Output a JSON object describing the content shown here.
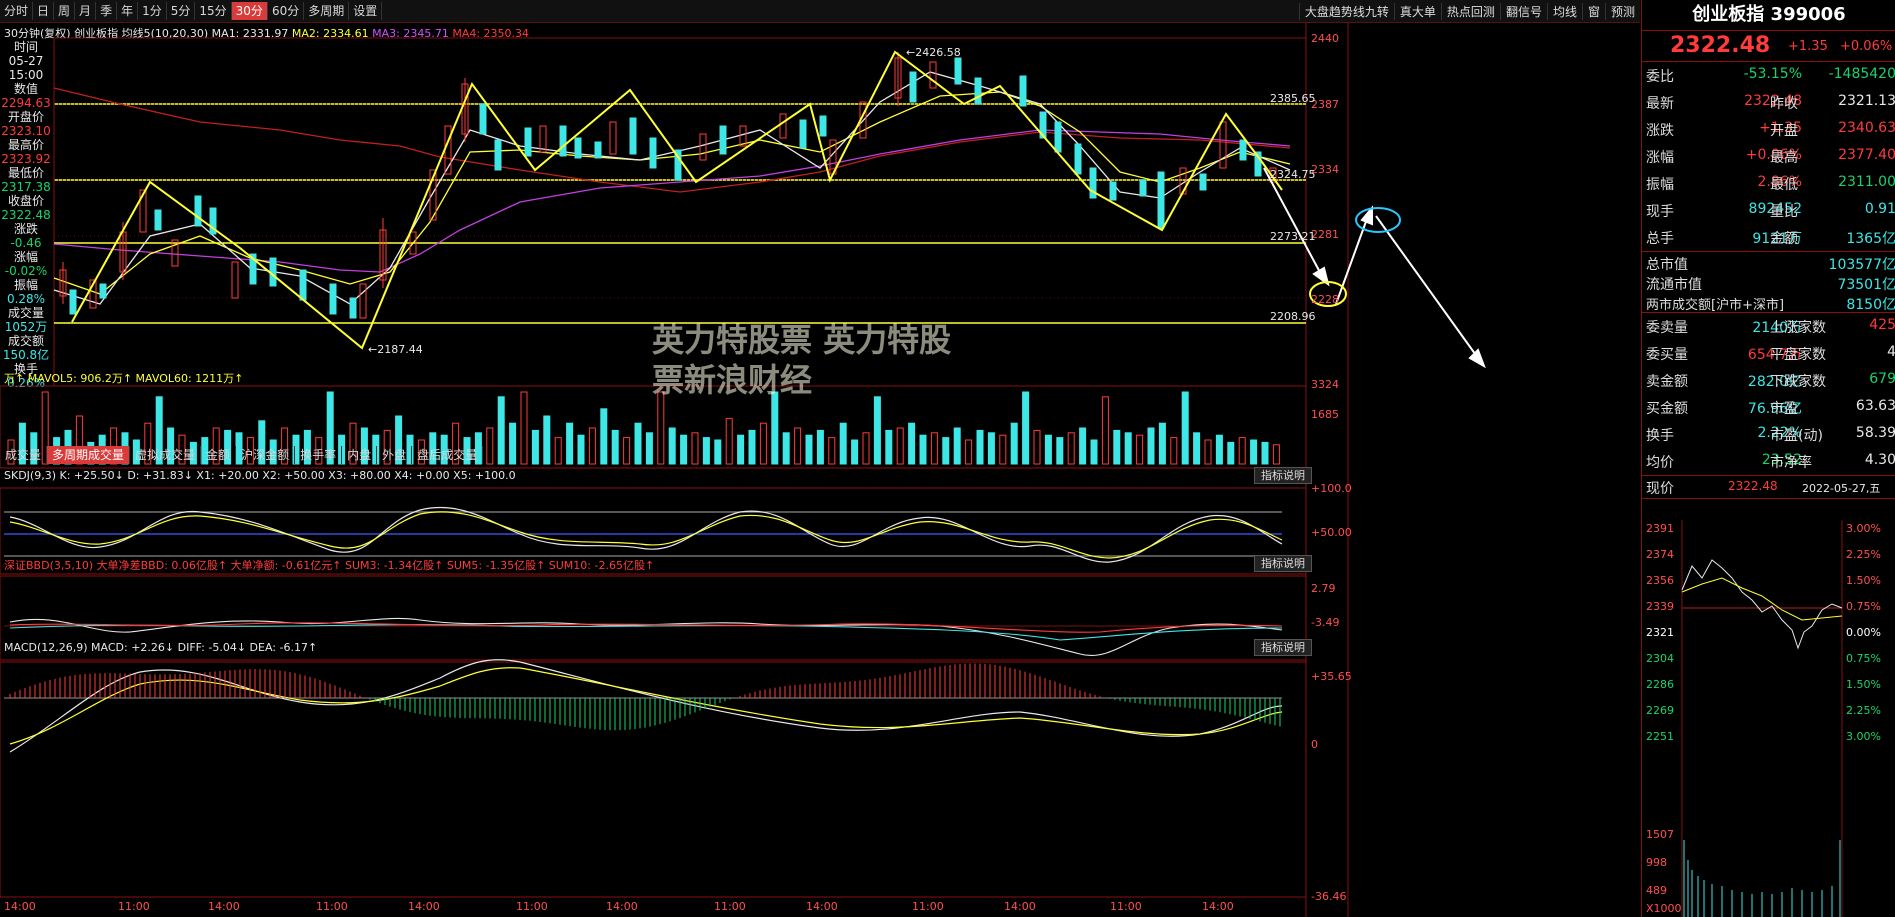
{
  "toolbar": {
    "tabs": [
      "分时",
      "日",
      "周",
      "月",
      "季",
      "年",
      "1分",
      "5分",
      "15分",
      "30分",
      "60分",
      "多周期",
      "设置"
    ],
    "active_tab": "30分",
    "right_items": [
      "大盘趋势线九转",
      "真大单",
      "热点回测",
      "翻信号",
      "均线",
      "窗",
      "预测"
    ]
  },
  "chart_header": {
    "period": "30分钟(复权)",
    "name": "创业板指",
    "ma_label": "均线5(10,20,30)",
    "ma1": "MA1: 2331.97",
    "ma2": "MA2: 2334.61",
    "ma3": "MA3: 2345.71",
    "ma4": "MA4: 2350.34"
  },
  "left_info": [
    {
      "label": "时间",
      "value": "05-27"
    },
    {
      "label": "",
      "value": "15:00"
    },
    {
      "label": "数值",
      "value": "2294.63"
    },
    {
      "label": "开盘价",
      "value": "2323.10"
    },
    {
      "label": "最高价",
      "value": "2323.92"
    },
    {
      "label": "最低价",
      "value": "2317.38"
    },
    {
      "label": "收盘价",
      "value": "2322.48"
    },
    {
      "label": "涨跌",
      "value": "-0.46"
    },
    {
      "label": "涨幅",
      "value": "-0.02%"
    },
    {
      "label": "振幅",
      "value": "0.28%"
    },
    {
      "label": "成交量",
      "value": "1052万"
    },
    {
      "label": "成交额",
      "value": "150.8亿"
    },
    {
      "label": "换手",
      "value": "0.26%"
    }
  ],
  "price_axis": [
    "2440",
    "2387",
    "2334",
    "2281",
    "2228"
  ],
  "annotations": {
    "high": "2426.58",
    "low": "2187.44",
    "line1": "2385.65",
    "line2": "2324.75",
    "line3": "2273.21",
    "line4": "2208.96"
  },
  "volume": {
    "header": "万↑ MAVOL5: 906.2万↑ MAVOL60: 1211万↑",
    "axis": [
      "3324",
      "1685"
    ]
  },
  "indicator_tabs": [
    "成交量",
    "多周期成交量",
    "虚拟成交量",
    "金额",
    "沪深金额",
    "换手率",
    "内盘",
    "外盘",
    "盘后成交量"
  ],
  "indicator_active": "多周期成交量",
  "skdj": {
    "header": "SKDJ(9,3) K: +25.50↓ D: +31.83↓ X1: +20.00 X2: +50.00 X3: +80.00 X4: +0.00 X5: +100.0",
    "axis": [
      "+100.0",
      "+50.00"
    ],
    "btn": "指标说明"
  },
  "bbd": {
    "header": "深证BBD(3,5,10) 大单净差BBD: 0.06亿股↑ 大单净额: -0.61亿元↑ SUM3: -1.34亿股↑ SUM5: -1.35亿股↑ SUM10: -2.65亿股↑",
    "axis": [
      "2.79",
      "-3.49"
    ],
    "btn": "指标说明"
  },
  "macd": {
    "header": "MACD(12,26,9) MACD: +2.26↓ DIFF: -5.04↓ DEA: -6.17↑",
    "axis": [
      "+35.65",
      "0",
      "-36.46"
    ],
    "btn": "指标说明"
  },
  "x_axis": [
    "14:00",
    "11:00",
    "14:00",
    "11:00",
    "14:00",
    "11:00",
    "14:00",
    "11:00",
    "14:00",
    "11:00",
    "14:00",
    "11:00",
    "14:00"
  ],
  "right_panel": {
    "title": "创业板指 399006",
    "price": "2322.48",
    "change": "+1.35",
    "change_pct": "+0.06%",
    "rows": [
      {
        "l": "委比",
        "v": "-53.15%",
        "l2": "",
        "v2": "-1485420"
      },
      {
        "l": "最新",
        "v": "2322.48",
        "l2": "昨收",
        "v2": "2321.13"
      },
      {
        "l": "涨跌",
        "v": "+1.35",
        "l2": "开盘",
        "v2": "2340.63"
      },
      {
        "l": "涨幅",
        "v": "+0.06%",
        "l2": "最高",
        "v2": "2377.40"
      },
      {
        "l": "振幅",
        "v": "2.86%",
        "l2": "最低",
        "v2": "2311.00"
      },
      {
        "l": "现手",
        "v": "892452",
        "l2": "量比",
        "v2": "0.91"
      },
      {
        "l": "总手",
        "v": "9121万",
        "l2": "金额",
        "v2": "1365亿"
      }
    ],
    "mkt_rows": [
      {
        "l": "总市值",
        "v": "103577亿"
      },
      {
        "l": "流通市值",
        "v": "73501亿"
      },
      {
        "l": "两市成交额[沪市+深市]",
        "v": "8150亿"
      }
    ],
    "rows2": [
      {
        "l": "委卖量",
        "v": "2140万",
        "l2": "上涨家数",
        "v2": "425"
      },
      {
        "l": "委买量",
        "v": "654.7万",
        "l2": "平盘家数",
        "v2": "4"
      },
      {
        "l": "卖金额",
        "v": "282.0亿",
        "l2": "下跌家数",
        "v2": "679"
      },
      {
        "l": "买金额",
        "v": "76.96亿",
        "l2": "市盈",
        "v2": "63.63"
      },
      {
        "l": "换手",
        "v": "2.22%",
        "l2": "市盈(动)",
        "v2": "58.39"
      },
      {
        "l": "均价",
        "v": "23.52",
        "l2": "市净率",
        "v2": "4.30"
      }
    ],
    "mini_header": {
      "l": "现价",
      "v": "2322.48",
      "date": "2022-05-27,五"
    },
    "mini_axis_left": [
      "2391",
      "2374",
      "2356",
      "2339",
      "2321",
      "2304",
      "2286",
      "2269",
      "2251"
    ],
    "mini_axis_right": [
      "3.00%",
      "2.25%",
      "1.50%",
      "0.75%",
      "0.00%",
      "0.75%",
      "1.50%",
      "2.25%",
      "3.00%"
    ],
    "mini_vol_axis": [
      "1507",
      "998",
      "489",
      "X1000"
    ]
  },
  "watermark": {
    "line1": "英力特股票 英力特股",
    "line2": "票新浪财经"
  }
}
